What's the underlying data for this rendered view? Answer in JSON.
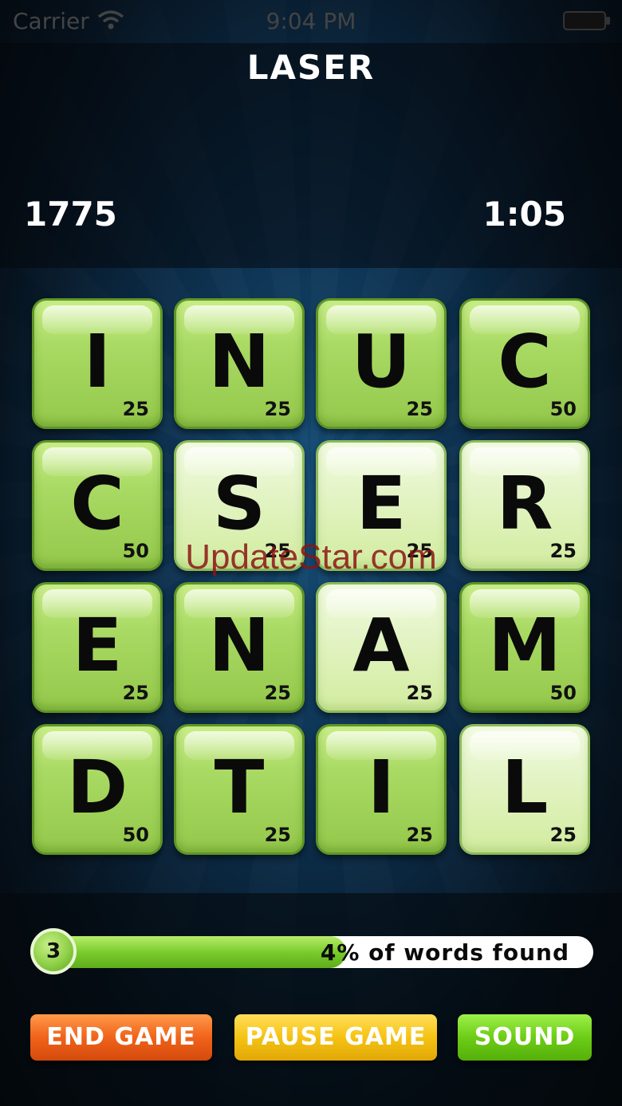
{
  "status_bar": {
    "carrier": "Carrier",
    "time": "9:04 PM"
  },
  "header": {
    "current_word": "LASER",
    "score": "1775",
    "timer": "1:05"
  },
  "board": {
    "tiles": [
      {
        "letter": "I",
        "points": "25",
        "selected": false
      },
      {
        "letter": "N",
        "points": "25",
        "selected": false
      },
      {
        "letter": "U",
        "points": "25",
        "selected": false
      },
      {
        "letter": "C",
        "points": "50",
        "selected": false
      },
      {
        "letter": "C",
        "points": "50",
        "selected": false
      },
      {
        "letter": "S",
        "points": "25",
        "selected": true
      },
      {
        "letter": "E",
        "points": "25",
        "selected": true
      },
      {
        "letter": "R",
        "points": "25",
        "selected": true
      },
      {
        "letter": "E",
        "points": "25",
        "selected": false
      },
      {
        "letter": "N",
        "points": "25",
        "selected": false
      },
      {
        "letter": "A",
        "points": "25",
        "selected": true
      },
      {
        "letter": "M",
        "points": "50",
        "selected": false
      },
      {
        "letter": "D",
        "points": "50",
        "selected": false
      },
      {
        "letter": "T",
        "points": "25",
        "selected": false
      },
      {
        "letter": "I",
        "points": "25",
        "selected": false
      },
      {
        "letter": "L",
        "points": "25",
        "selected": true
      }
    ]
  },
  "watermark": "UpdateStar.com",
  "progress": {
    "words_found_count": "3",
    "text": "4% of words found",
    "fill_fraction": 0.56
  },
  "buttons": {
    "end_game": "END GAME",
    "pause_game": "PAUSE GAME",
    "sound": "SOUND"
  },
  "colors": {
    "tile_green": "#a9da64",
    "tile_selected": "#e4f4c6",
    "end_button": "#f0631a",
    "pause_button": "#f5c313",
    "sound_button": "#6dcd16"
  }
}
